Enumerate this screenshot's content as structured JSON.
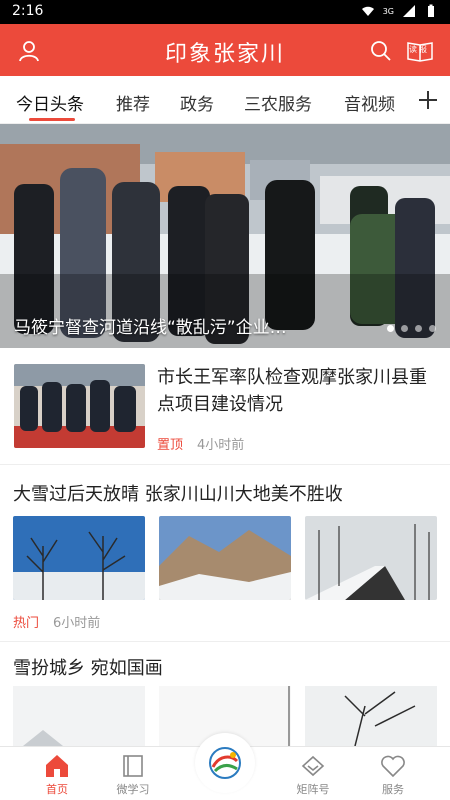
{
  "status_bar": {
    "time": "2:16",
    "network": "3G"
  },
  "header": {
    "title": "印象张家川",
    "read_label": "读报"
  },
  "tabs": [
    {
      "label": "今日头条",
      "active": true
    },
    {
      "label": "推荐"
    },
    {
      "label": "政务"
    },
    {
      "label": "三农服务"
    },
    {
      "label": "音视频"
    }
  ],
  "hero": {
    "caption": "马筱宁督查河道沿线“散乱污”企业…",
    "dots": 4,
    "active_dot": 0
  },
  "articles": [
    {
      "title": "市长王军率队检查观摩张家川县重点项目建设情况",
      "tag": "置顶",
      "time": "4小时前"
    },
    {
      "title": "大雪过后天放晴 张家川山川大地美不胜收",
      "tag": "热门",
      "time": "6小时前"
    },
    {
      "title": "雪扮城乡 宛如国画"
    }
  ],
  "bottom_nav": [
    {
      "label": "首页",
      "active": true,
      "icon": "home-icon"
    },
    {
      "label": "微学习",
      "icon": "book-icon"
    },
    {
      "label": "",
      "icon": "center-logo-icon"
    },
    {
      "label": "矩阵号",
      "icon": "diamond-icon"
    },
    {
      "label": "服务",
      "icon": "heart-icon"
    }
  ],
  "colors": {
    "accent": "#ec4a3b",
    "hot": "#ec4a3b"
  }
}
